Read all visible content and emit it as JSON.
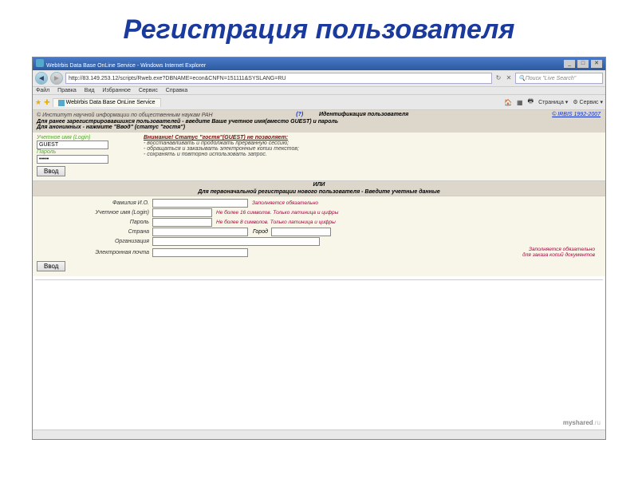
{
  "slide": {
    "title": "Регистрация пользователя"
  },
  "browser": {
    "title": "WebIrbis Data Base OnLine Service - Windows Internet Explorer",
    "url": "http://83.149.253.12/scripts/Rweb.exe?DBNAME=econ&CNFN=151111&SYSLANG=RU",
    "search_placeholder": "Поиск \"Live Search\"",
    "menu": {
      "file": "Файл",
      "edit": "Правка",
      "view": "Вид",
      "favorites": "Избранное",
      "tools": "Сервис",
      "help": "Справка"
    },
    "tab": "WebIrbis Data Base OnLine Service",
    "tools_page": "Страница",
    "tools_service": "Сервис"
  },
  "page": {
    "inst": "© Институт научной информации по общественным наукам РАН",
    "qmark": "(?)",
    "ident": "Идентификация пользователя",
    "copyright": "© IRBIS 1992-2007",
    "line2": "Для ранее зарегистрировавшихся пользователей - введите Ваше учетное имя(вместо GUEST) и пароль",
    "line3": "Для анонимных - нажмите \"Ввод\" (статус \"гостя\")"
  },
  "login": {
    "login_label": "Учетное имя (Login)",
    "login_value": "GUEST",
    "password_label": "Пароль",
    "password_value": "•••••",
    "submit": "Ввод",
    "warn_title": "Внимание! Статус \"гостя\"(GUEST) не позволяет:",
    "warn1": "- восстанавливать и продолжать прерванную сессию;",
    "warn2": "- обращаться и заказывать электронные копии текстов;",
    "warn3": "- сохранять и повторно использовать запрос."
  },
  "divider": {
    "ili": "ИЛИ",
    "reg_title": "Для первоначальной регистрации нового пользователя - Введите учетные данные"
  },
  "reg": {
    "fio": "Фамилия И.О.",
    "fio_hint": "Заполняется обязательно",
    "login": "Учетное имя (Login)",
    "login_hint": "Не более 16 символов. Только латиница и цифры",
    "password": "Пароль",
    "password_hint": "Не более 8 символов. Только латиница и цифры",
    "country": "Страна",
    "city": "Город",
    "org": "Организация",
    "email": "Электронная почта",
    "email_hint1": "Заполняется обязательно",
    "email_hint2": "для заказа копий документов",
    "submit": "Ввод"
  },
  "watermark": {
    "domain": "myshared",
    "suffix": ".ru"
  }
}
